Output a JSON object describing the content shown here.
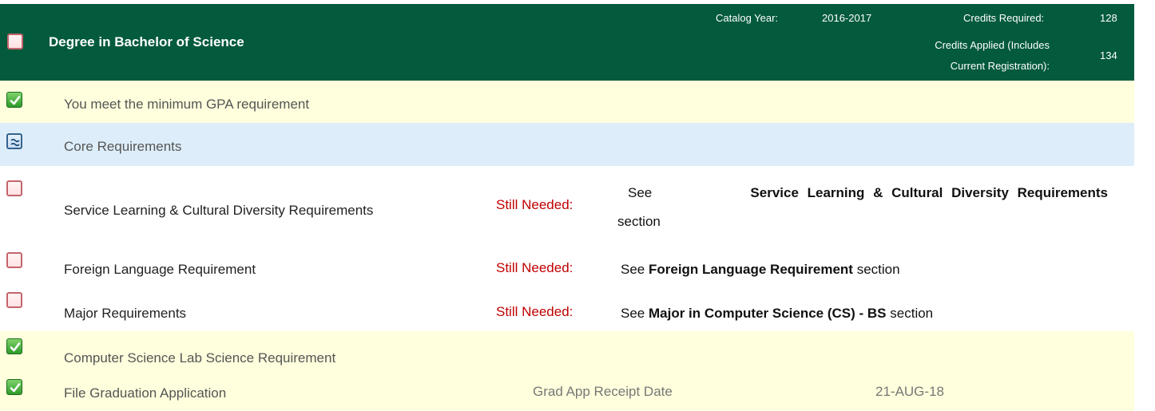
{
  "header": {
    "title": "Degree in Bachelor of Science",
    "catalog_year_label": "Catalog Year:",
    "catalog_year_value": "2016-2017",
    "credits_required_label": "Credits Required:",
    "credits_required_value": "128",
    "credits_applied_label_line1": "Credits Applied (Includes",
    "credits_applied_label_line2": "Current Registration):",
    "credits_applied_value": "134",
    "status_icon": "empty-box-icon"
  },
  "rows": {
    "gpa": {
      "label": "You meet the minimum GPA requirement",
      "status_icon": "checkmark-icon"
    },
    "core": {
      "label": "Core Requirements",
      "status_icon": "approx-icon"
    },
    "service_learning": {
      "label": "Service Learning & Cultural Diversity Requirements",
      "needed_label": "Still Needed:",
      "see": "See",
      "see_bold": "Service Learning & Cultural Diversity Requirements",
      "section": "section",
      "status_icon": "empty-box-icon"
    },
    "foreign_language": {
      "label": "Foreign Language Requirement",
      "needed_label": "Still Needed:",
      "see": "See",
      "see_bold": "Foreign Language Requirement",
      "section": "section",
      "status_icon": "empty-box-icon"
    },
    "major": {
      "label": "Major Requirements",
      "needed_label": "Still Needed:",
      "see": "See",
      "see_bold": "Major in Computer Science (CS) - BS",
      "section": "section",
      "status_icon": "empty-box-icon"
    },
    "lab_science": {
      "label": "Computer Science Lab Science Requirement",
      "status_icon": "checkmark-icon"
    },
    "graduation": {
      "label": "File Graduation Application",
      "receipt_label": "Grad App Receipt Date",
      "receipt_value": "21-AUG-18",
      "status_icon": "checkmark-icon"
    }
  },
  "colors": {
    "header_bg": "#035a3c",
    "met_row_bg": "#ffffdd",
    "in_progress_row_bg": "#ddeefa",
    "still_needed": "#c00000"
  }
}
